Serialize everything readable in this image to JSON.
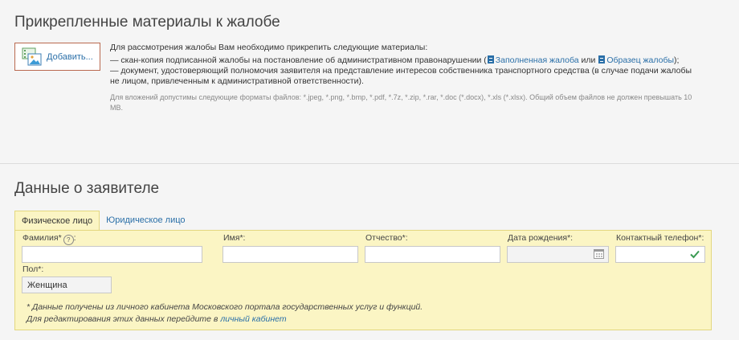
{
  "attachments": {
    "title": "Прикрепленные материалы к жалобе",
    "add_button_label": "Добавить...",
    "intro": "Для рассмотрения жалобы Вам необходимо прикрепить следующие материалы:",
    "item1_prefix": "— скан-копия подписанной жалобы на постановление об административном правонарушении (",
    "item1_link1": "Заполненная жалоба",
    "item1_middle": " или ",
    "item1_link2": "Образец жалобы",
    "item1_suffix": ");",
    "item2": "— документ, удостоверяющий полномочия заявителя на представление интересов собственника транспортного средства (в случае подачи жалобы не лицом, привлеченным к административной ответственности).",
    "formats_note": "Для вложений допустимы следующие форматы файлов: *.jpeg, *.png, *.bmp, *.pdf, *.7z, *.zip, *.rar, *.doc (*.docx), *.xls (*.xlsx). Общий объем файлов не должен превышать 10 МВ."
  },
  "applicant": {
    "title": "Данные о заявителе",
    "tabs": [
      {
        "label": "Физическое лицо",
        "active": true
      },
      {
        "label": "Юридическое лицо",
        "active": false
      }
    ],
    "fields": {
      "surname_label": "Фамилия*",
      "surname_value": "",
      "name_label": "Имя*:",
      "name_value": "",
      "patronymic_label": "Отчество*:",
      "patronymic_value": "",
      "birthdate_label": "Дата рождения*:",
      "birthdate_value": "",
      "phone_label": "Контактный телефон*:",
      "phone_value": "",
      "gender_label": "Пол*:",
      "gender_value": "Женщина"
    },
    "note_line1": "* Данные получены из личного кабинета Московского портала государственных услуг и функций.",
    "note_line2_prefix": "Для редактирования этих данных перейдите в ",
    "note_link": "личный кабинет"
  },
  "colors": {
    "link": "#2a6fa8",
    "panel_bg": "#fbf5c4",
    "panel_border": "#e3d77e",
    "button_border": "#b9694f",
    "check": "#3a9a52"
  },
  "icons": {
    "add_button": "image-files-icon",
    "doc": "document-icon",
    "help": "question-circle-icon",
    "calendar": "calendar-icon",
    "valid": "checkmark-icon"
  }
}
